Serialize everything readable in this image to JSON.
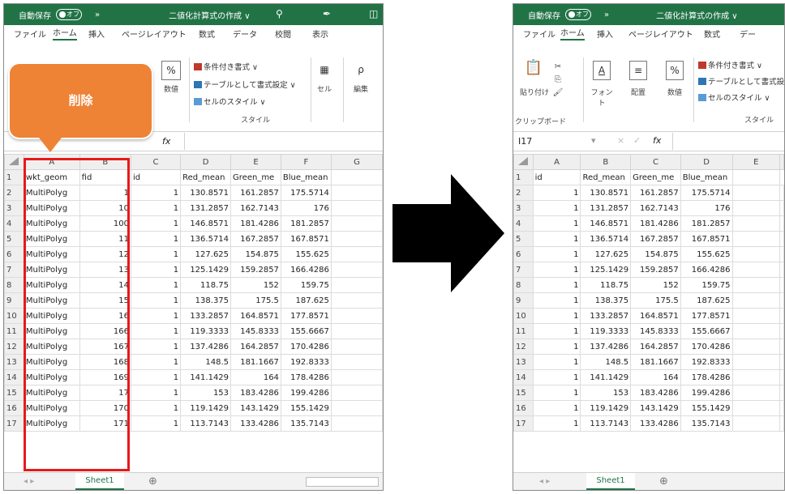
{
  "titlebar": {
    "autosave": "自動保存",
    "toggle": "オフ",
    "quick": "»",
    "doc_title": "二値化計算式の作成 ∨",
    "search_icon": "search-icon",
    "pen_icon": "pen-icon",
    "close_icon": "close-icon"
  },
  "menu": [
    "ファイル",
    "ホーム",
    "挿入",
    "ページレイアウト",
    "数式",
    "データ",
    "校閲",
    "表示"
  ],
  "menu_right": [
    "ファイル",
    "ホーム",
    "挿入",
    "ページレイアウト",
    "数式",
    "デー"
  ],
  "ribbon": {
    "paste": "貼り付け",
    "clipboard": "クリップボード",
    "font": "フォント",
    "align": "配置",
    "number": "数値",
    "cell": "セル",
    "edit": "編集",
    "cond": "条件付き書式 ∨",
    "table": "テーブルとして書式設定 ∨",
    "cellstyle": "セルのスタイル ∨",
    "styles": "スタイル",
    "pct": "%",
    "font_icon": "A",
    "align_icon": "≡",
    "search_icon": "ρ"
  },
  "formula": {
    "fx": "fx",
    "namebox_right": "I17",
    "cancel": "×",
    "enter": "✓"
  },
  "callout": "削除",
  "left_sheet": {
    "columns": [
      "A",
      "B",
      "C",
      "D",
      "E",
      "F",
      "G"
    ],
    "header_row": [
      "wkt_geom",
      "fid",
      "id",
      "Red_mean",
      "Green_me",
      "Blue_mean",
      ""
    ],
    "rows": [
      [
        "MultiPolyg",
        "1",
        "1",
        "130.8571",
        "161.2857",
        "175.5714"
      ],
      [
        "MultiPolyg",
        "10",
        "1",
        "131.2857",
        "162.7143",
        "176"
      ],
      [
        "MultiPolyg",
        "100",
        "1",
        "146.8571",
        "181.4286",
        "181.2857"
      ],
      [
        "MultiPolyg",
        "11",
        "1",
        "136.5714",
        "167.2857",
        "167.8571"
      ],
      [
        "MultiPolyg",
        "12",
        "1",
        "127.625",
        "154.875",
        "155.625"
      ],
      [
        "MultiPolyg",
        "13",
        "1",
        "125.1429",
        "159.2857",
        "166.4286"
      ],
      [
        "MultiPolyg",
        "14",
        "1",
        "118.75",
        "152",
        "159.75"
      ],
      [
        "MultiPolyg",
        "15",
        "1",
        "138.375",
        "175.5",
        "187.625"
      ],
      [
        "MultiPolyg",
        "16",
        "1",
        "133.2857",
        "164.8571",
        "177.8571"
      ],
      [
        "MultiPolyg",
        "166",
        "1",
        "119.3333",
        "145.8333",
        "155.6667"
      ],
      [
        "MultiPolyg",
        "167",
        "1",
        "137.4286",
        "164.2857",
        "170.4286"
      ],
      [
        "MultiPolyg",
        "168",
        "1",
        "148.5",
        "181.1667",
        "192.8333"
      ],
      [
        "MultiPolyg",
        "169",
        "1",
        "141.1429",
        "164",
        "178.4286"
      ],
      [
        "MultiPolyg",
        "17",
        "1",
        "153",
        "183.4286",
        "199.4286"
      ],
      [
        "MultiPolyg",
        "170",
        "1",
        "119.1429",
        "143.1429",
        "155.1429"
      ],
      [
        "MultiPolyg",
        "171",
        "1",
        "113.7143",
        "133.4286",
        "135.7143"
      ]
    ]
  },
  "right_sheet": {
    "columns": [
      "A",
      "B",
      "C",
      "D",
      "E"
    ],
    "header_row": [
      "id",
      "Red_mean",
      "Green_me",
      "Blue_mean",
      ""
    ],
    "rows": [
      [
        "1",
        "130.8571",
        "161.2857",
        "175.5714"
      ],
      [
        "1",
        "131.2857",
        "162.7143",
        "176"
      ],
      [
        "1",
        "146.8571",
        "181.4286",
        "181.2857"
      ],
      [
        "1",
        "136.5714",
        "167.2857",
        "167.8571"
      ],
      [
        "1",
        "127.625",
        "154.875",
        "155.625"
      ],
      [
        "1",
        "125.1429",
        "159.2857",
        "166.4286"
      ],
      [
        "1",
        "118.75",
        "152",
        "159.75"
      ],
      [
        "1",
        "138.375",
        "175.5",
        "187.625"
      ],
      [
        "1",
        "133.2857",
        "164.8571",
        "177.8571"
      ],
      [
        "1",
        "119.3333",
        "145.8333",
        "155.6667"
      ],
      [
        "1",
        "137.4286",
        "164.2857",
        "170.4286"
      ],
      [
        "1",
        "148.5",
        "181.1667",
        "192.8333"
      ],
      [
        "1",
        "141.1429",
        "164",
        "178.4286"
      ],
      [
        "1",
        "153",
        "183.4286",
        "199.4286"
      ],
      [
        "1",
        "119.1429",
        "143.1429",
        "155.1429"
      ],
      [
        "1",
        "113.7143",
        "133.4286",
        "135.7143"
      ]
    ]
  },
  "sheet_tab": "Sheet1",
  "add_sheet": "⊕",
  "colors": {
    "excel_green": "#217346",
    "callout": "#ee8235",
    "highlight": "#e81919"
  }
}
